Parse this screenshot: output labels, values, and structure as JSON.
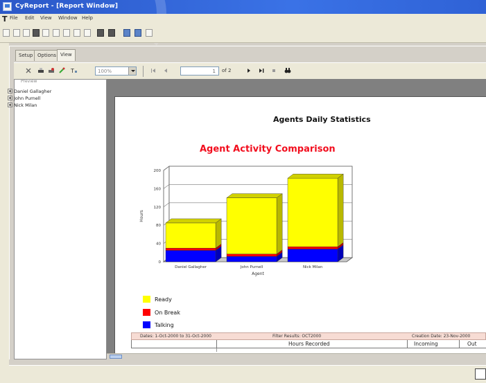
{
  "window": {
    "title": "CyReport - [Report Window]"
  },
  "menu": {
    "items": [
      "File",
      "Edit",
      "View",
      "Window",
      "Help"
    ]
  },
  "tabs": [
    {
      "label": "Setup",
      "active": false
    },
    {
      "label": "Options",
      "active": false
    },
    {
      "label": "View",
      "active": true
    }
  ],
  "viewer": {
    "zoom": "100%",
    "page_current": "1",
    "page_total_label": "of 2"
  },
  "tree": {
    "caption": "Preview",
    "items": [
      "Daniel Gallagher",
      "John Purnell",
      "Nick Milan"
    ]
  },
  "report": {
    "title": "Agents Daily Statistics",
    "chart_title": "Agent Activity Comparison",
    "legend": [
      {
        "label": "Ready",
        "color": "#ffff00"
      },
      {
        "label": "On Break",
        "color": "#ff0000"
      },
      {
        "label": "Talking",
        "color": "#0000ff"
      }
    ],
    "info": {
      "dates": "Dates: 1-Oct-2000 to 31-Oct-2000",
      "filter": "Filter Results:  OCT2000",
      "creation": "Creation Date:  23-Nov-2000"
    },
    "table_headers": [
      "Hours Recorded",
      "Incoming",
      "Out"
    ]
  },
  "chart_data": {
    "type": "bar",
    "stacked": true,
    "categories": [
      "Daniel Gallagher",
      "John Purnell",
      "Nick Milan"
    ],
    "series": [
      {
        "name": "Talking",
        "color": "#0000ff",
        "values": [
          25,
          12,
          28
        ]
      },
      {
        "name": "On Break",
        "color": "#ff0000",
        "values": [
          5,
          5,
          5
        ]
      },
      {
        "name": "Ready",
        "color": "#ffff00",
        "values": [
          55,
          123,
          150
        ]
      }
    ],
    "xlabel": "Agent",
    "ylabel": "Hours",
    "ylim": [
      0,
      200
    ],
    "yticks": [
      0,
      40,
      80,
      120,
      160,
      200
    ],
    "grid": true,
    "legend_position": "bottom-left"
  }
}
